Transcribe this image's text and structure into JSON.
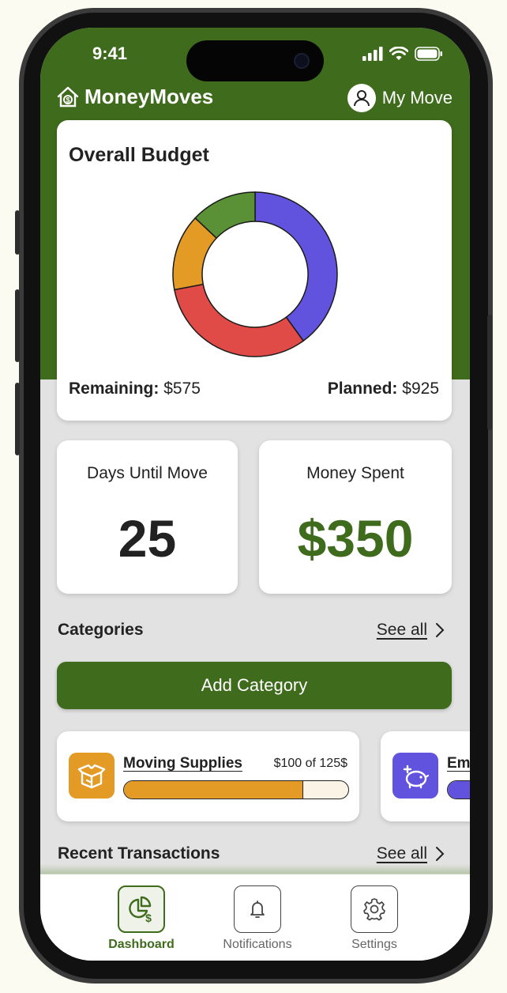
{
  "status_bar": {
    "time": "9:41"
  },
  "header": {
    "brand": "MoneyMoves",
    "account_label": "My Move"
  },
  "budget": {
    "title": "Overall Budget",
    "remaining_label": "Remaining:",
    "remaining_value": "$575",
    "planned_label": "Planned:",
    "planned_value": "$925",
    "colors": [
      "#6153de",
      "#e04a47",
      "#e39b25",
      "#5a9136"
    ]
  },
  "chart_data": {
    "type": "pie",
    "values": [
      40,
      32,
      15,
      13
    ],
    "colors": [
      "#6153de",
      "#e04a47",
      "#e39b25",
      "#5a9136"
    ]
  },
  "stats": {
    "days_label": "Days Until Move",
    "days_value": "25",
    "spent_label": "Money Spent",
    "spent_value": "$350"
  },
  "categories": {
    "title": "Categories",
    "see_all": "See all",
    "add_label": "Add Category",
    "items": [
      {
        "name": "Moving Supplies",
        "amount": "$100 of 125$",
        "progress": 0.8,
        "color": "#e39b25",
        "icon": "box-icon"
      },
      {
        "name": "Em",
        "progress": 0.6,
        "color": "#6153de",
        "icon": "piggy-bank-icon"
      }
    ]
  },
  "transactions": {
    "title": "Recent Transactions",
    "see_all": "See all"
  },
  "tabbar": {
    "items": [
      {
        "label": "Dashboard",
        "icon": "dashboard-icon",
        "active": true
      },
      {
        "label": "Notifications",
        "icon": "bell-icon",
        "active": false
      },
      {
        "label": "Settings",
        "icon": "gear-icon",
        "active": false
      }
    ]
  },
  "colors": {
    "primary": "#3f6b1c",
    "background": "#e2e2e2"
  }
}
